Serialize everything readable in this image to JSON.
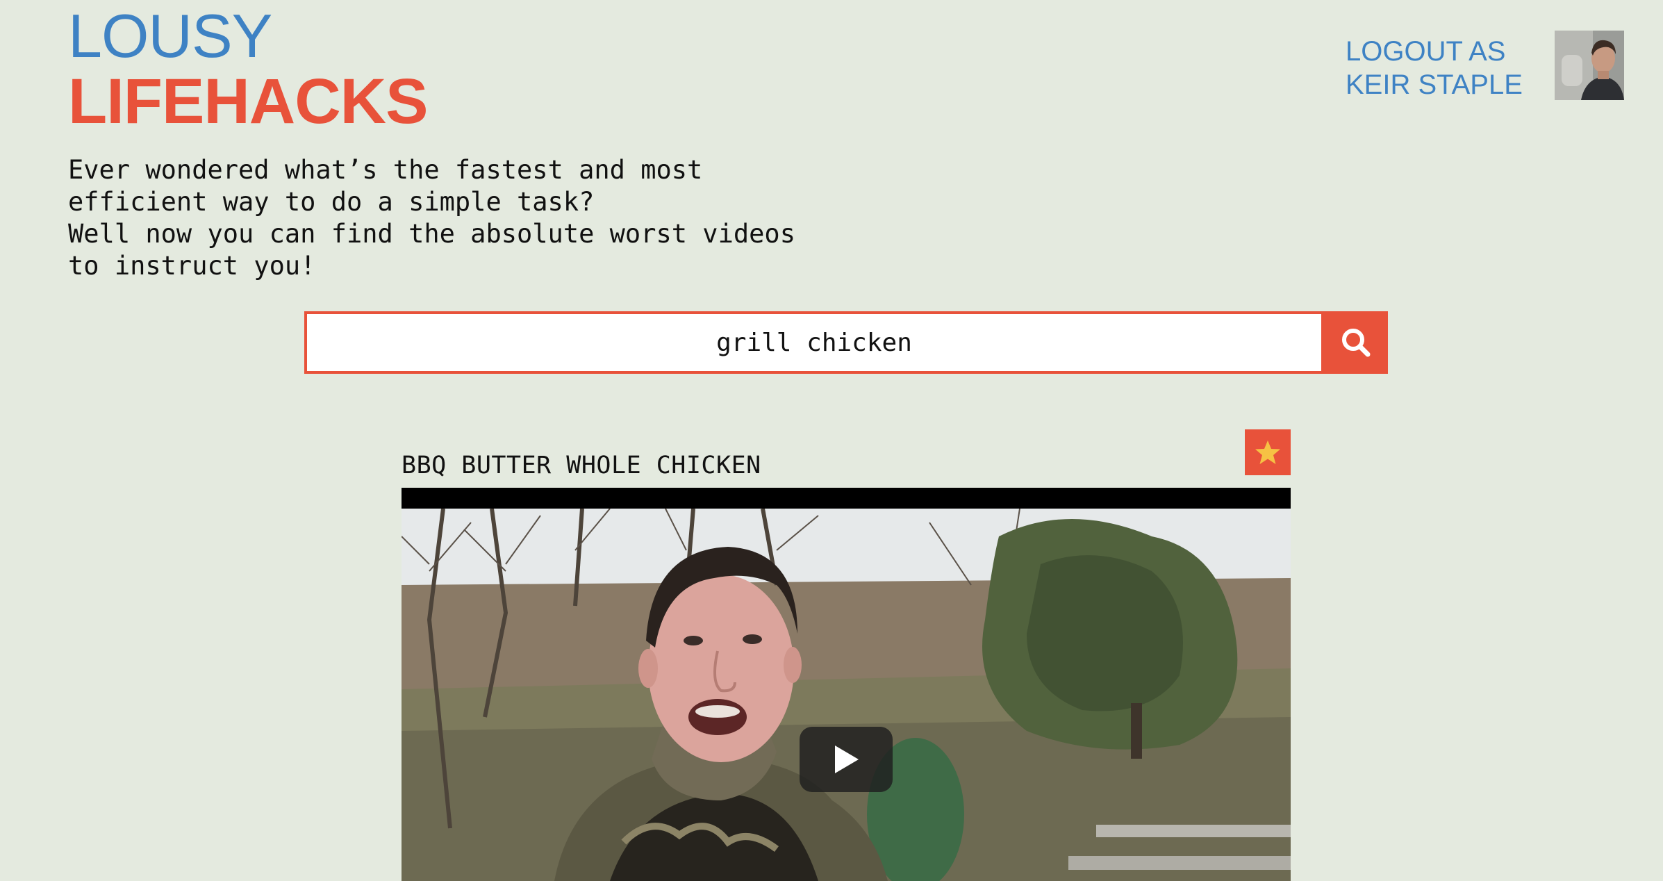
{
  "brand": {
    "line1": "LOUSY",
    "line2": "LIFEHACKS",
    "color_primary": "#3e82c4",
    "color_accent": "#e8523a"
  },
  "header": {
    "logout_label": "LOGOUT AS KEIR STAPLE",
    "avatar_icon": "user-avatar"
  },
  "tagline": "Ever wondered what’s the fastest and most\nefficient way to do a simple task?\nWell now you can find the absolute worst videos\nto instruct you!",
  "search": {
    "value": "grill chicken",
    "button_icon": "search-icon"
  },
  "results": [
    {
      "title": "BBQ BUTTER WHOLE CHICKEN",
      "favorite_icon": "star-icon",
      "play_icon": "play-icon"
    }
  ],
  "colors": {
    "background": "#e4eadf",
    "star": "#f6c244"
  }
}
